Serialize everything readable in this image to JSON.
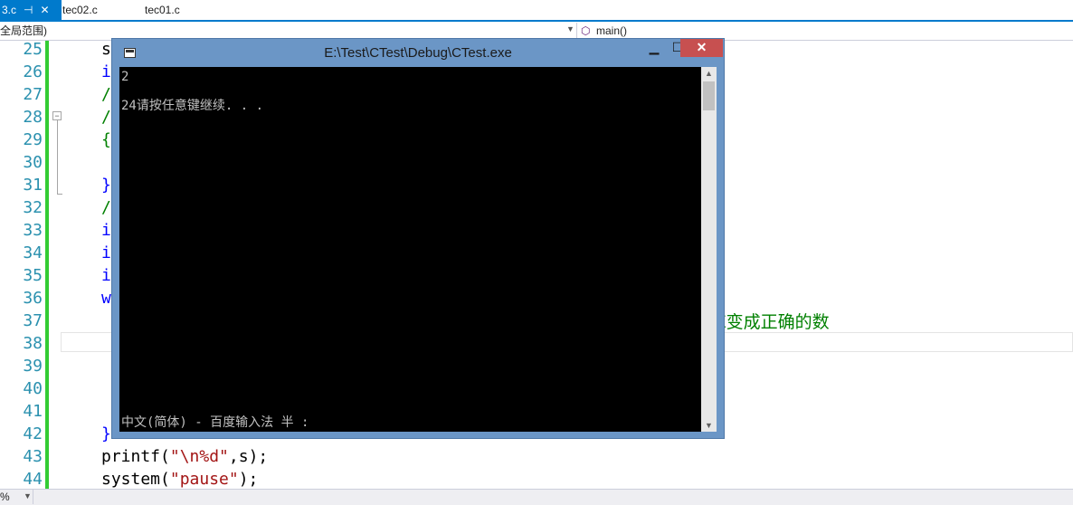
{
  "tabs": [
    {
      "label": "3.c",
      "active": true
    },
    {
      "label": "tec02.c",
      "active": false
    },
    {
      "label": "tec01.c",
      "active": false
    }
  ],
  "tab_pin_glyph": "⊣",
  "tab_close_glyph": "✕",
  "navbar": {
    "scope": "全局范围)",
    "member": "main()"
  },
  "editor": {
    "line_numbers": [
      "25",
      "26",
      "27",
      "28",
      "29",
      "30",
      "31",
      "32",
      "33",
      "34",
      "35",
      "36",
      "37",
      "38",
      "39",
      "40",
      "41",
      "42",
      "43",
      "44"
    ],
    "lines": [
      "s",
      "i",
      "/",
      "/",
      "{",
      "",
      "}",
      "/",
      "i",
      "i",
      "i",
      "w",
      "",
      "",
      "",
      "",
      "",
      "}",
      "",
      ""
    ],
    "printf_fn": "printf(",
    "printf_str": "\"\\n%d\"",
    "printf_rest": ",s);",
    "system_fn": "system(",
    "system_str": "\"pause\"",
    "system_rest": ");",
    "comment_tail": "E变成正确的数"
  },
  "status": {
    "zoom": "%"
  },
  "console": {
    "title": "E:\\Test\\CTest\\Debug\\CTest.exe",
    "min_glyph": "▁",
    "max_glyph": "☐",
    "close_glyph": "✕",
    "output_line1": "2",
    "output_line2": "24请按任意键继续. . .",
    "ime_status": "中文(简体) - 百度输入法 半 :"
  }
}
